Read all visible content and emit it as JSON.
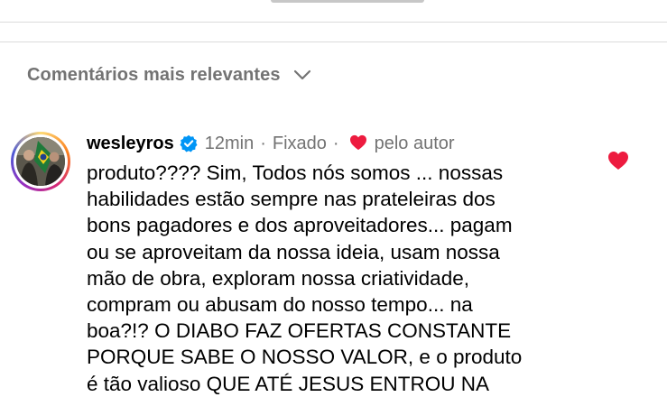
{
  "sort": {
    "label": "Comentários mais relevantes",
    "icon": "chevron-down-icon"
  },
  "comment": {
    "username": "wesleyros",
    "verified": true,
    "time": "12min",
    "separator": "·",
    "pinned": "Fixado",
    "liked_by_author_label": "pelo autor",
    "text": "produto???? Sim, Todos nós somos ... nossas\nhabilidades estão sempre nas prateleiras dos\nbons pagadores e dos aproveitadores... pagam\nou se aproveitam da nossa  ideia, usam nossa\nmão de obra, exploram nossa criatividade,\ncompram ou abusam do nosso tempo... na\nboa?!? O DIABO FAZ OFERTAS CONSTANTE\nPORQUE SABE O NOSSO VALOR, e o produto\né tão valioso QUE ATÉ JESUS ENTROU NA",
    "liked": true
  },
  "colors": {
    "secondary_text": "#737373",
    "verified_blue": "#0095f6",
    "heart_red": "#ed1b3f",
    "divider": "#dbdbdb"
  }
}
